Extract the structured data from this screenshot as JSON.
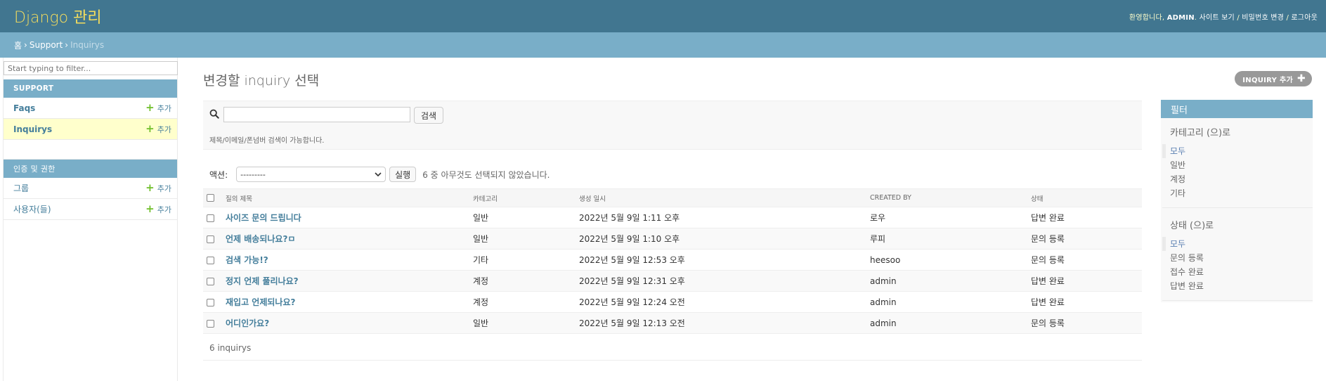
{
  "header": {
    "brand": "Django 관리",
    "welcome": "환영합니다,",
    "username": "ADMIN",
    "view_site": "사이트 보기",
    "change_password": "비밀번호 변경",
    "logout": "로그아웃"
  },
  "breadcrumbs": {
    "home": "홈",
    "app": "Support",
    "current": "Inquirys"
  },
  "sidebar": {
    "filter_placeholder": "Start typing to filter...",
    "modules": [
      {
        "caption": "SUPPORT",
        "models": [
          {
            "name": "Faqs",
            "add": "추가"
          },
          {
            "name": "Inquirys",
            "add": "추가"
          }
        ]
      },
      {
        "caption": "인증 및 권한",
        "models": [
          {
            "name": "그룹",
            "add": "추가"
          },
          {
            "name": "사용자(들)",
            "add": "추가"
          }
        ]
      }
    ]
  },
  "main": {
    "title": "변경할 inquiry 선택",
    "add_button": "INQUIRY 추가",
    "search": {
      "value": "",
      "button": "검색",
      "help": "제목/이메일/폰넘버 검색이 가능합니다."
    },
    "actions": {
      "label": "액션:",
      "selected": "---------",
      "go": "실행",
      "counter": "6 중 아무것도 선택되지 않았습니다."
    },
    "table": {
      "columns": [
        "질의 제목",
        "카테고리",
        "생성 일시",
        "CREATED BY",
        "상태"
      ],
      "rows": [
        [
          "사이즈 문의 드립니다",
          "일반",
          "2022년 5월 9일 1:11 오후",
          "로우",
          "답변 완료"
        ],
        [
          "언제 배송되나요?ㅁ",
          "일반",
          "2022년 5월 9일 1:10 오후",
          "루피",
          "문의 등록"
        ],
        [
          "검색 가능!?",
          "기타",
          "2022년 5월 9일 12:53 오후",
          "heesoo",
          "문의 등록"
        ],
        [
          "정지 언제 풀리나요?",
          "계정",
          "2022년 5월 9일 12:31 오후",
          "admin",
          "답변 완료"
        ],
        [
          "재입고 언제되나요?",
          "계정",
          "2022년 5월 9일 12:24 오전",
          "admin",
          "답변 완료"
        ],
        [
          "어디인가요?",
          "일반",
          "2022년 5월 9일 12:13 오전",
          "admin",
          "문의 등록"
        ]
      ]
    },
    "paginator": "6 inquirys"
  },
  "filter": {
    "title": "필터",
    "groups": [
      {
        "title": "카테고리 (으)로",
        "options": [
          "모두",
          "일반",
          "계정",
          "기타"
        ],
        "selected": 0
      },
      {
        "title": "상태 (으)로",
        "options": [
          "모두",
          "문의 등록",
          "접수 완료",
          "답변 완료"
        ],
        "selected": 0
      }
    ]
  },
  "colors": {
    "header": "#417690",
    "breadcrumbs": "#79aec8",
    "link": "#447e9b",
    "add": "#70bf2b",
    "current_row": "#ffffcc"
  }
}
